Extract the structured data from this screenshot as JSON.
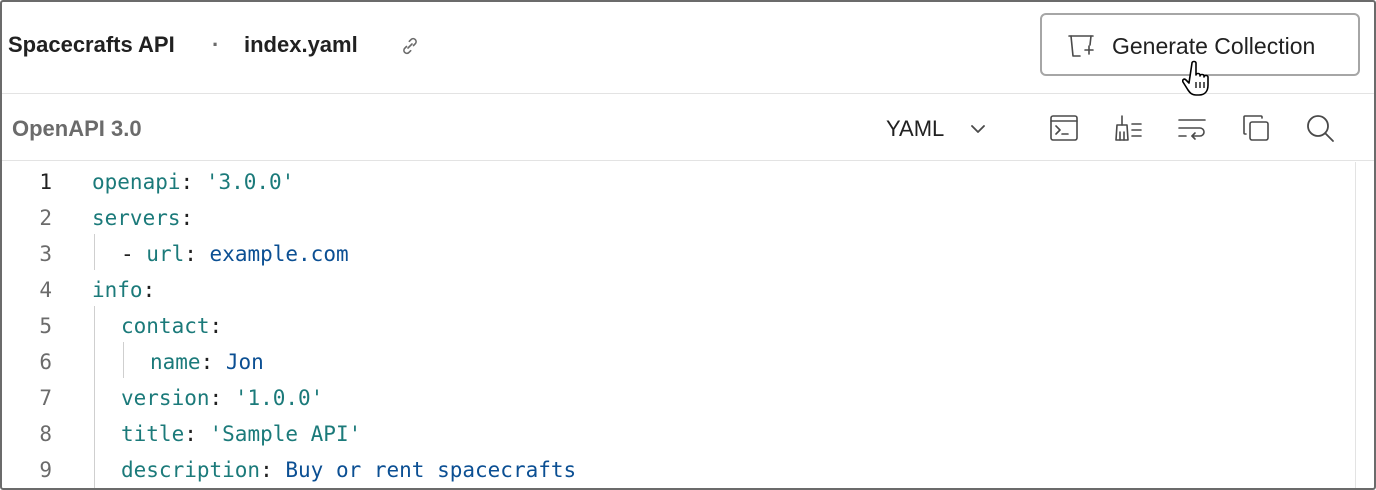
{
  "header": {
    "api_name": "Spacecrafts API",
    "separator": "·",
    "filename": "index.yaml",
    "link_icon": "link-icon",
    "generate_button_label": "Generate Collection",
    "generate_button_icon": "collection-add-icon"
  },
  "toolbar": {
    "spec_version": "OpenAPI 3.0",
    "format": "YAML",
    "tools": [
      "terminal-icon",
      "beautify-icon",
      "wrap-lines-icon",
      "copy-icon",
      "search-icon"
    ]
  },
  "editor": {
    "lines": [
      {
        "num": "1",
        "key": "openapi",
        "colon": ":",
        "value": " '3.0.0'"
      },
      {
        "num": "2",
        "key": "servers",
        "colon": ":",
        "value": ""
      },
      {
        "num": "3",
        "dash": "- ",
        "key": "url",
        "colon": ":",
        "value": " example.com"
      },
      {
        "num": "4",
        "key": "info",
        "colon": ":",
        "value": ""
      },
      {
        "num": "5",
        "key": "contact",
        "colon": ":",
        "value": ""
      },
      {
        "num": "6",
        "key": "name",
        "colon": ":",
        "value": " Jon"
      },
      {
        "num": "7",
        "key": "version",
        "colon": ":",
        "value": " '1.0.0'"
      },
      {
        "num": "8",
        "key": "title",
        "colon": ":",
        "value": " 'Sample API'"
      },
      {
        "num": "9",
        "key": "description",
        "colon": ":",
        "value": " Buy or rent spacecrafts"
      }
    ]
  },
  "colors": {
    "key": "#1b7a7a",
    "value": "#0b4f93",
    "border": "#a6a6a6"
  }
}
